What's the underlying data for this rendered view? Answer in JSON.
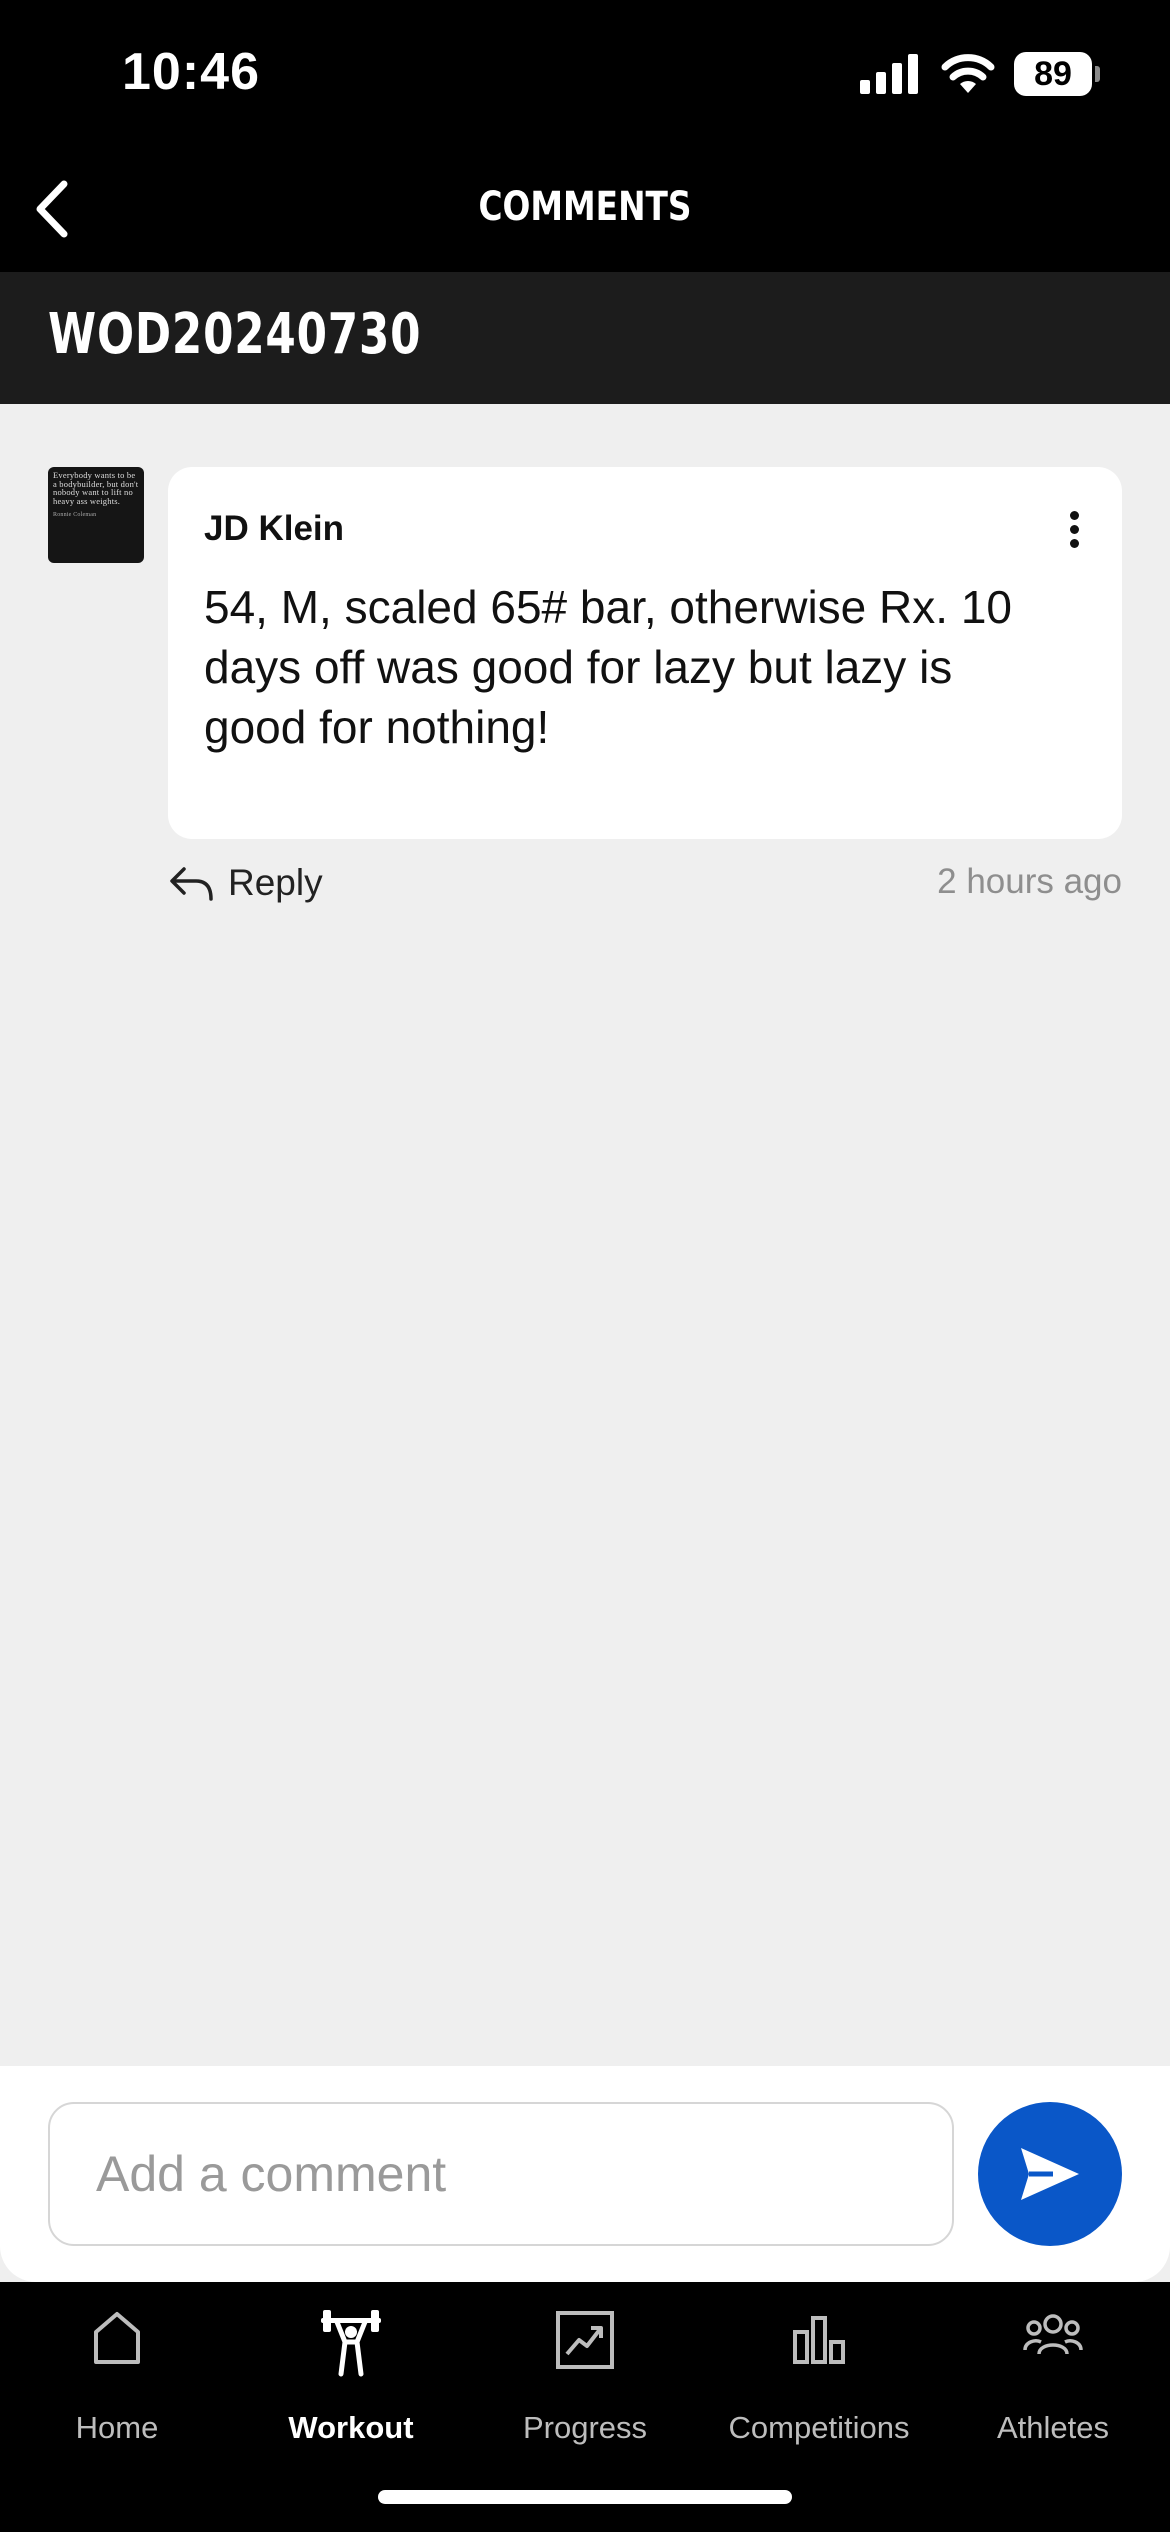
{
  "status_bar": {
    "time": "10:46",
    "battery": "89",
    "icons": [
      "signal-icon",
      "wifi-icon",
      "battery-icon"
    ]
  },
  "header": {
    "title": "COMMENTS",
    "back_icon": "chevron-left-icon"
  },
  "wod": {
    "title": "WOD20240730"
  },
  "comments": [
    {
      "author": "JD Klein",
      "text": "54, M, scaled 65# bar, otherwise Rx. 10 days off was good for lazy but lazy is good for nothing!",
      "time": "2 hours ago",
      "reply_label": "Reply",
      "avatar_quote": "Everybody wants to be a bodybuilder, but don't nobody want to lift no heavy ass weights.",
      "avatar_credit": "Ronnie Coleman"
    }
  ],
  "composer": {
    "placeholder": "Add a comment",
    "value": "",
    "send_icon": "send-icon",
    "accent": "#0a57c8"
  },
  "tabs": [
    {
      "label": "Home",
      "icon": "home-icon",
      "active": false
    },
    {
      "label": "Workout",
      "icon": "barbell-icon",
      "active": true
    },
    {
      "label": "Progress",
      "icon": "trend-chart-icon",
      "active": false
    },
    {
      "label": "Competitions",
      "icon": "podium-icon",
      "active": false
    },
    {
      "label": "Athletes",
      "icon": "people-icon",
      "active": false
    }
  ]
}
